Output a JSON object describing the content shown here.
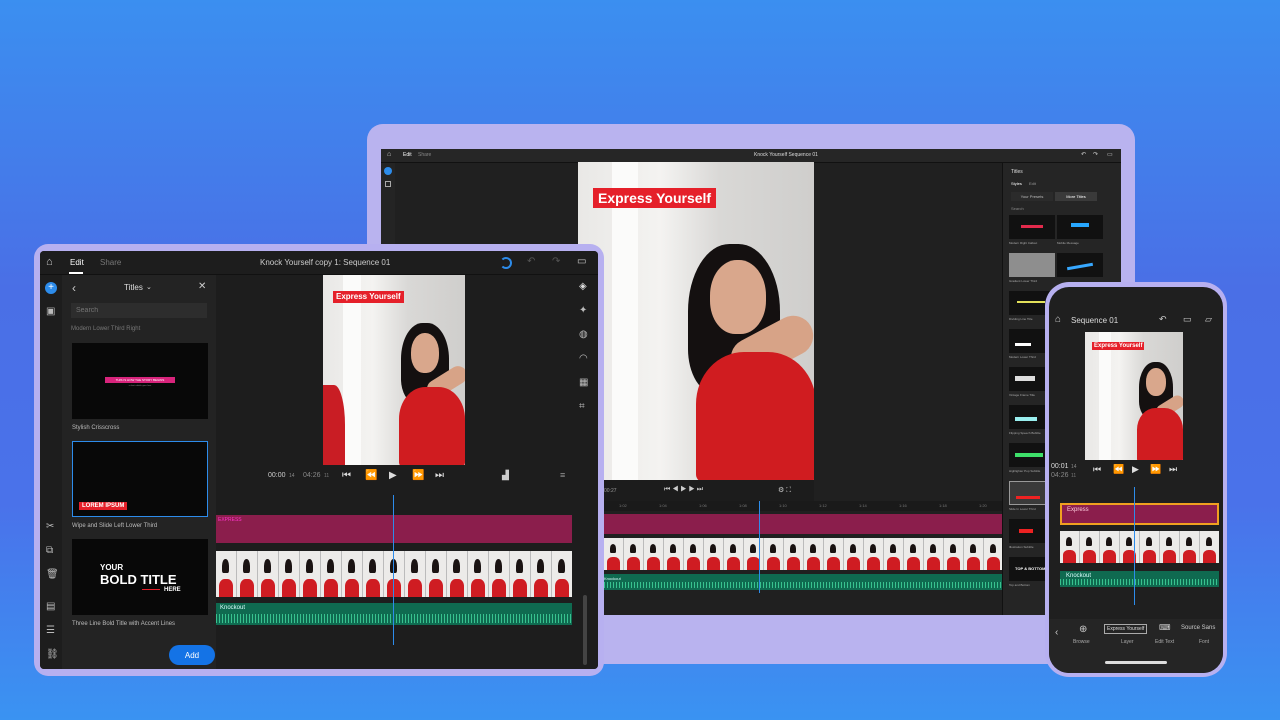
{
  "laptop": {
    "tabs": [
      "Edit",
      "Share"
    ],
    "window_title": "Knock Yourself Sequence 01",
    "panel_title": "Titles",
    "panel_tabs": [
      "Styles",
      "Edit"
    ],
    "panel_subtabs": [
      "Your Presets",
      "More Titles"
    ],
    "search_label": "Search",
    "title_text": "Express Yourself",
    "timecode": "00:27",
    "template_labels": [
      "Modern Right Callout",
      "Mobile Message",
      "Gradient Lower Third",
      "",
      "Dividing Line Title",
      "",
      "Modern Lower Third",
      "",
      "Vintage Frame Title",
      "",
      "Flipping Speech Bubble",
      "",
      "Highlighter Pop Subtitle",
      "",
      "Slide In Lower Third",
      "",
      "Illustration Subtitle",
      "",
      "Top and Bottom",
      ""
    ],
    "template_texts": {
      "top_bottom": "TOP & BOTTOM"
    },
    "ruler": [
      "1:00",
      "1:02",
      "1:04",
      "1:06",
      "1:08",
      "1:10",
      "1:12",
      "1:14",
      "1:16",
      "1:18",
      "1:20"
    ],
    "audio_label": "Knockout"
  },
  "tablet": {
    "tabs": {
      "edit": "Edit",
      "share": "Share"
    },
    "window_title": "Knock Yourself copy 1: Sequence 01",
    "panel_title": "Titles",
    "search_placeholder": "Search",
    "cut_label": "Modern Lower Third Right",
    "items": [
      {
        "label": "Stylish Crisscross",
        "text1": "THIS IS HOW THE STORY BEGINS",
        "text2": "a short subtitle goes here"
      },
      {
        "label": "Wipe and Slide Left Lower Third",
        "text1": "LOREM IPSUM"
      },
      {
        "label": "Three Line Bold Title with Accent Lines",
        "line1": "YOUR",
        "line2": "BOLD TITLE",
        "line3": "HERE"
      }
    ],
    "add_button": "Add",
    "title_text": "Express Yourself",
    "current_time": "00:00",
    "current_frames": "14",
    "duration": "04:26",
    "duration_frames": "11",
    "track_label": "EXPRESS",
    "audio_label": "Knockout"
  },
  "phone": {
    "title": "Sequence 01",
    "title_text": "Express Yourself",
    "current_time": "00:01",
    "current_frames": "14",
    "duration": "04:26",
    "duration_frames": "11",
    "track_label": "Express",
    "audio_label": "Knockout",
    "toolbar": {
      "browse": "Browse",
      "layer_value": "Express Yourself",
      "layer": "Layer",
      "edit_text": "Edit Text",
      "font_value": "Source Sans",
      "font": "Font"
    }
  },
  "colors": {
    "accent": "#2d8ceb",
    "title_red": "#e5202a",
    "track_purple": "#8b1e4c",
    "track_green": "#0f6a50",
    "button_blue": "#1473e6"
  }
}
